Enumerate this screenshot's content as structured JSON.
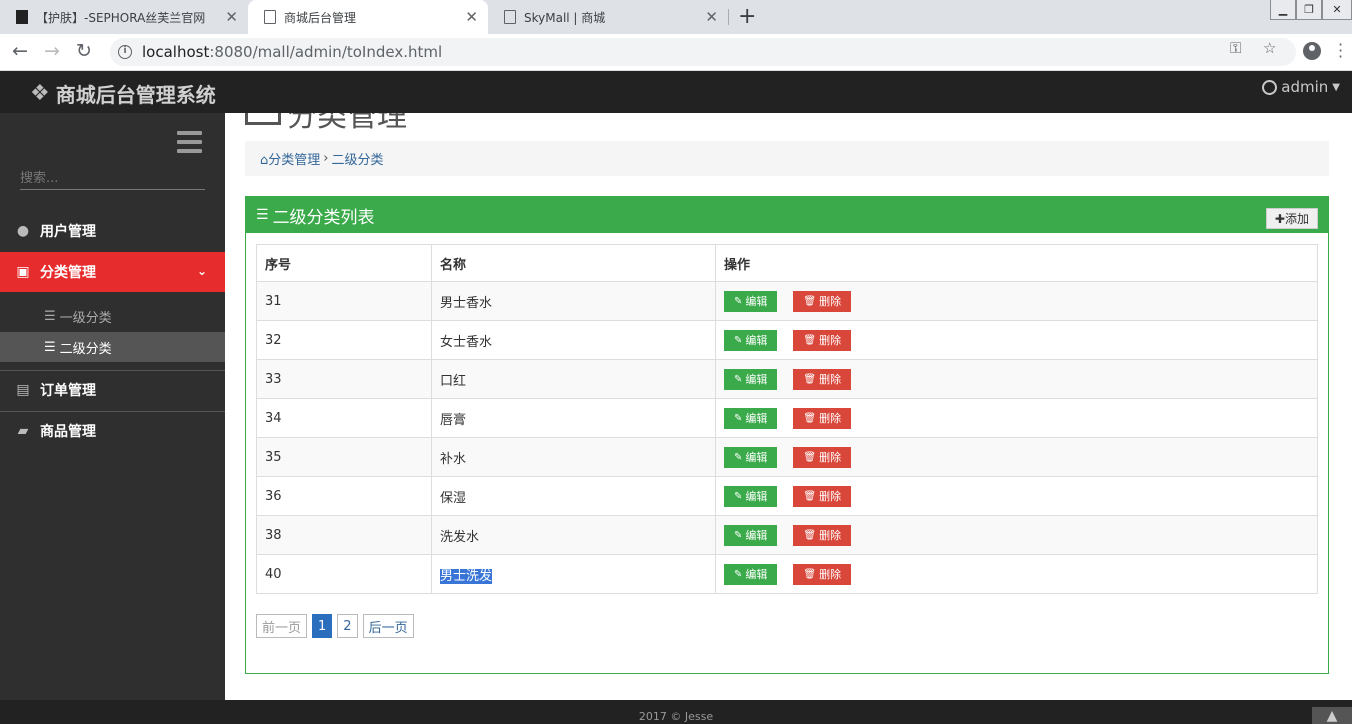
{
  "browser": {
    "tabs": [
      {
        "title": "【护肤】-SEPHORA丝芙兰官网"
      },
      {
        "title": "商城后台管理"
      },
      {
        "title": "SkyMall | 商城"
      }
    ],
    "url_host": "localhost",
    "url_rest": ":8080/mall/admin/toIndex.html"
  },
  "app": {
    "brand": "商城后台管理系统",
    "user": "admin"
  },
  "sidebar": {
    "search_placeholder": "搜索...",
    "items": [
      {
        "label": "用户管理",
        "icon": "user-circle-icon"
      },
      {
        "label": "分类管理",
        "icon": "category-icon"
      },
      {
        "label": "订单管理",
        "icon": "file-icon"
      },
      {
        "label": "商品管理",
        "icon": "shopping-bag-icon"
      }
    ],
    "sub": [
      {
        "label": "一级分类"
      },
      {
        "label": "二级分类"
      }
    ]
  },
  "main": {
    "page_title": "分类管理",
    "breadcrumb": [
      "分类管理",
      "二级分类"
    ],
    "panel_title": "二级分类列表",
    "add_label": "添加",
    "columns": [
      "序号",
      "名称",
      "操作"
    ],
    "edit_label": "编辑",
    "delete_label": "删除",
    "rows": [
      {
        "id": "31",
        "name": "男士香水"
      },
      {
        "id": "32",
        "name": "女士香水"
      },
      {
        "id": "33",
        "name": "口红"
      },
      {
        "id": "34",
        "name": "唇膏"
      },
      {
        "id": "35",
        "name": "补水"
      },
      {
        "id": "36",
        "name": "保湿"
      },
      {
        "id": "38",
        "name": "洗发水"
      },
      {
        "id": "40",
        "name": "男士洗发"
      }
    ],
    "pager": {
      "prev": "前一页",
      "p1": "1",
      "p2": "2",
      "next": "后一页"
    }
  },
  "footer": {
    "text": "2017 © Jesse"
  },
  "colors": {
    "accent_green": "#3aaa4a",
    "accent_red": "#e62c2c",
    "delete_red": "#d9463a",
    "page_blue": "#2a6ebd"
  }
}
